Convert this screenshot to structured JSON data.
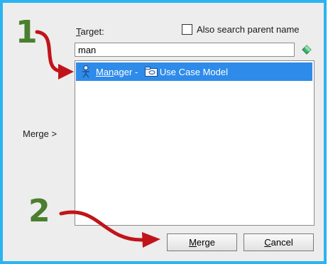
{
  "dialog": {
    "target_label_prefix": "T",
    "target_label_rest": "arget:",
    "also_search_label": "Also search parent name",
    "also_search_checked": false,
    "search_value": "man",
    "result_row": {
      "prefix_underlined": "Man",
      "prefix_rest": "ager",
      "separator": " - ",
      "model_name": "Use Case Model",
      "icon_actor": "actor-icon",
      "icon_model": "model-icon"
    },
    "merge_side_label": "Merge >",
    "merge_button": {
      "mnemonic": "M",
      "rest": "erge"
    },
    "cancel_button": {
      "mnemonic": "C",
      "rest": "ancel"
    }
  },
  "annotations": {
    "step1": "1",
    "step2": "2",
    "arrow_color": "#c0141a",
    "number_color": "#4a7f2e"
  },
  "colors": {
    "frame": "#2bb3f0",
    "selection": "#2f8bea"
  }
}
